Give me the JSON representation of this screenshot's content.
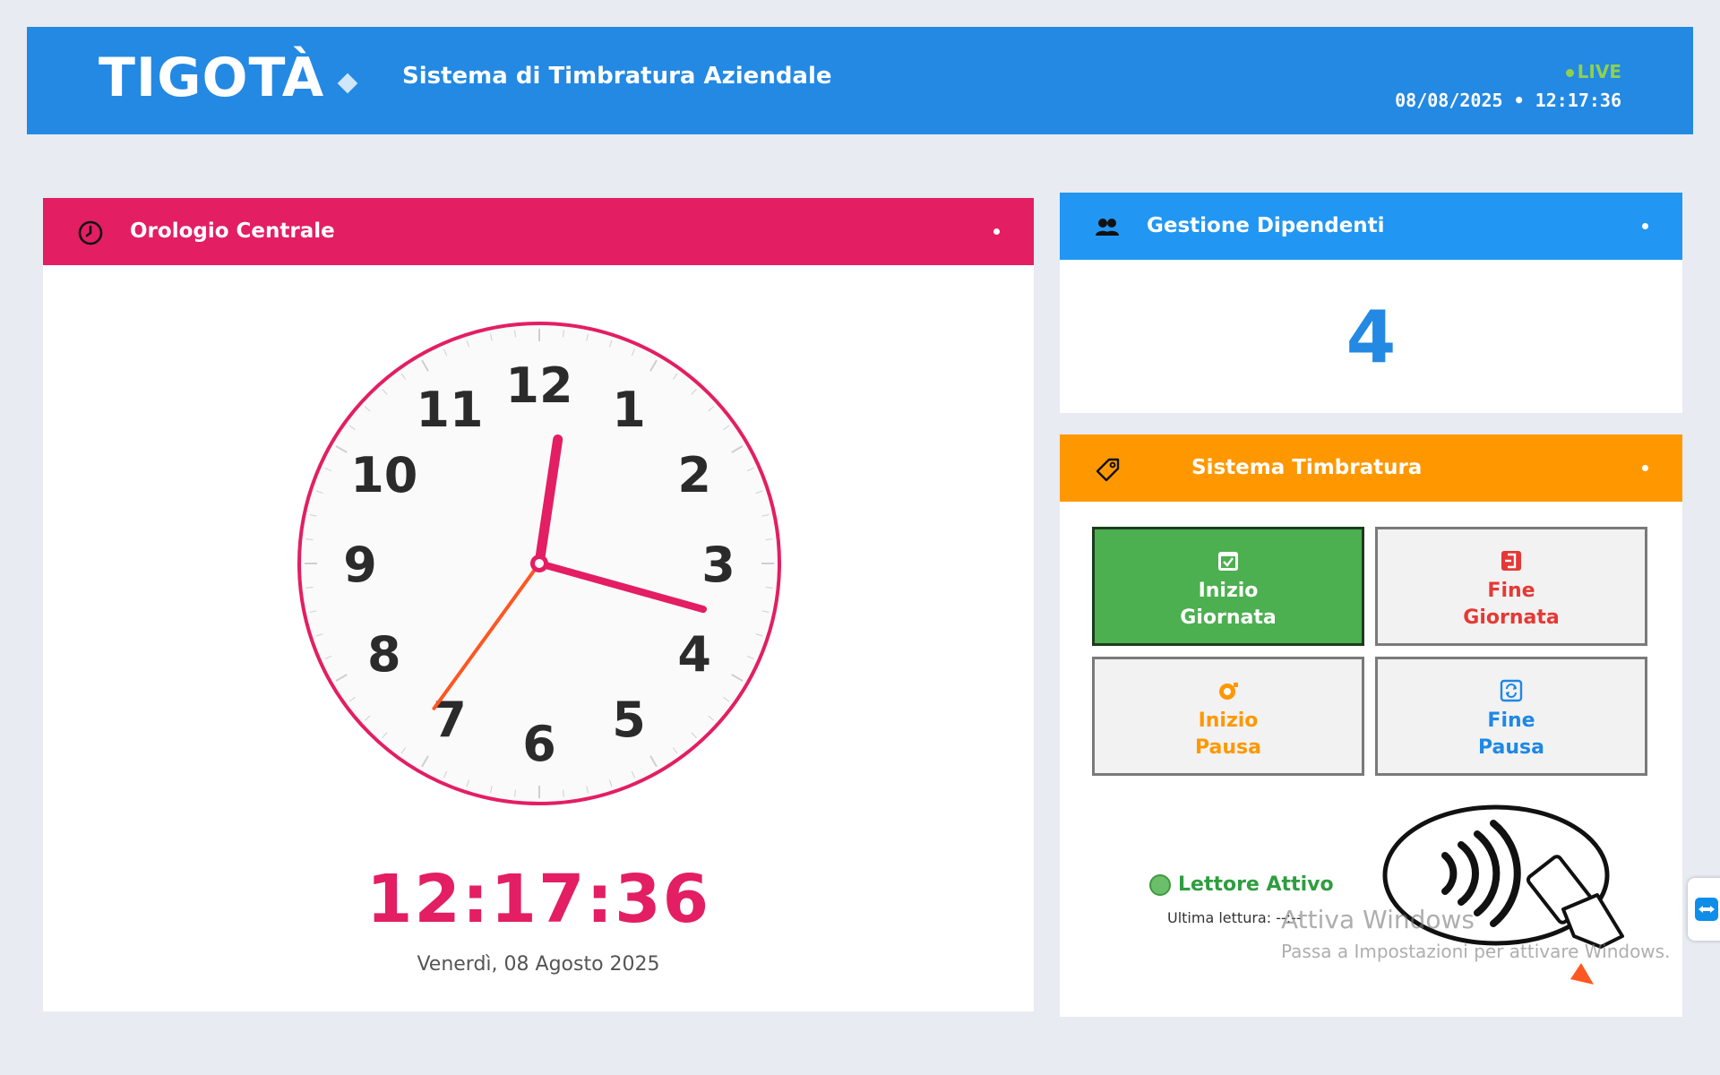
{
  "header": {
    "brand": "TIGOTÀ",
    "subtitle": "Sistema di Timbratura Aziendale",
    "live_label": "LIVE",
    "datetime": "08/08/2025 • 12:17:36"
  },
  "clock_panel": {
    "title": "Orologio Centrale",
    "icon": "clock-icon",
    "dial_numbers": [
      "12",
      "1",
      "2",
      "3",
      "4",
      "5",
      "6",
      "7",
      "8",
      "9",
      "10",
      "11"
    ],
    "time": {
      "hours": 12,
      "minutes": 17,
      "seconds": 36
    },
    "digital_time": "12:17:36",
    "date_text": "Venerdì, 08 Agosto 2025"
  },
  "employees_panel": {
    "title": "Gestione Dipendenti",
    "icon": "users-icon",
    "count": "4"
  },
  "stamp_panel": {
    "title": "Sistema Timbratura",
    "icon": "tag-icon",
    "buttons": {
      "start_day": {
        "line1": "Inizio",
        "line2": "Giornata"
      },
      "end_day": {
        "line1": "Fine",
        "line2": "Giornata"
      },
      "start_break": {
        "line1": "Inizio",
        "line2": "Pausa"
      },
      "end_break": {
        "line1": "Fine",
        "line2": "Pausa"
      }
    },
    "reader_status": "Lettore Attivo",
    "last_read": "Ultima lettura: --:--"
  },
  "watermark": {
    "line1": "Attiva Windows",
    "line2": "Passa a Impostazioni per attivare Windows."
  },
  "colors": {
    "header": "#2389e3",
    "clock_accent": "#e31e63",
    "second_hand": "#ff5722",
    "employees": "#2196f3",
    "stamp": "#ff9800",
    "start_day_button": "#4caf50"
  }
}
